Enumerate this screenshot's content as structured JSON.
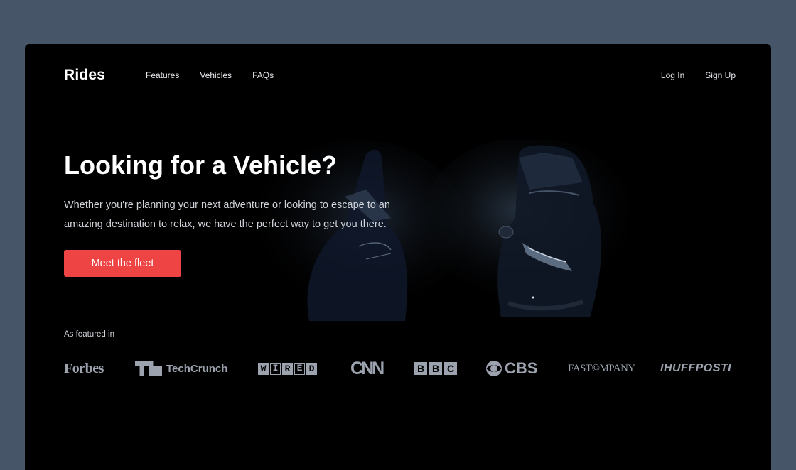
{
  "brand": {
    "name": "Rides"
  },
  "nav": {
    "links": [
      "Features",
      "Vehicles",
      "FAQs"
    ],
    "login": "Log In",
    "signup": "Sign Up"
  },
  "hero": {
    "title": "Looking for a Vehicle?",
    "subtitle": "Whether you're planning your next adventure or looking to escape to an amazing destination to relax, we have the perfect way to get you there.",
    "cta": "Meet the fleet"
  },
  "featured": {
    "label": "As featured in",
    "logos": {
      "forbes": "Forbes",
      "techcrunch": "TechCrunch",
      "wired": [
        "W",
        "I",
        "R",
        "E",
        "D"
      ],
      "cnn": "CNN",
      "bbc": [
        "B",
        "B",
        "C"
      ],
      "cbs": "CBS",
      "fastcompany": "FAST©MPANY",
      "huffpost": "IHUFFPOSTI"
    }
  },
  "colors": {
    "page_background": "#475569",
    "frame_background": "#000000",
    "accent": "#ef4444",
    "logo_gray": "#9ca3af"
  }
}
